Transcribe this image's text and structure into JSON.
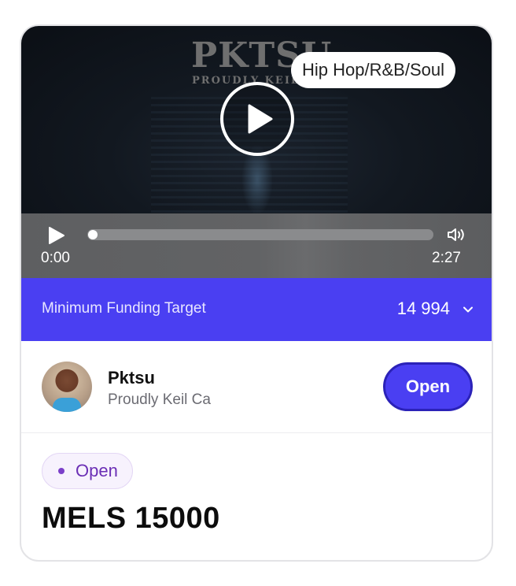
{
  "cover": {
    "art_title": "PKTSU",
    "art_subtitle": "PROUDLY KEIL",
    "genre": "Hip Hop/R&B/Soul"
  },
  "player": {
    "current_time": "0:00",
    "duration": "2:27",
    "progress": 0
  },
  "funding": {
    "label": "Minimum Funding Target",
    "value": "14 994"
  },
  "artist": {
    "name": "Pktsu",
    "subtitle": "Proudly Keil Ca",
    "open_button": "Open"
  },
  "campaign": {
    "status": "Open",
    "amount": "MELS 15000"
  },
  "colors": {
    "accent": "#4a3ff2",
    "status_purple": "#6b2fb5"
  },
  "icons": [
    "play-icon",
    "volume-icon",
    "chevron-down-icon"
  ]
}
